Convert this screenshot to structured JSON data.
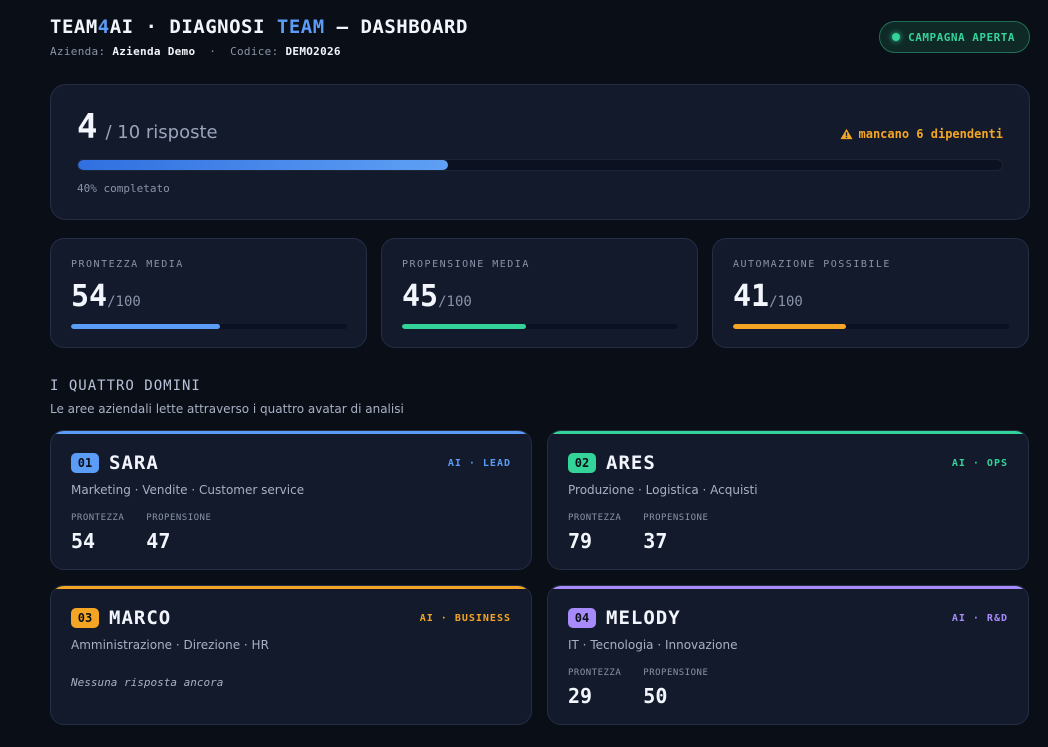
{
  "header": {
    "title_part1": "TEAM",
    "title_part2": "4",
    "title_part3": "AI · DIAGNOSI ",
    "title_part4": "TEAM",
    "title_part5": " — DASHBOARD",
    "azienda_label": "Azienda:",
    "azienda_value": "Azienda Demo",
    "sep": "·",
    "codice_label": "Codice:",
    "codice_value": "DEMO2026",
    "status_badge": "CAMPAGNA APERTA"
  },
  "progress": {
    "count": "4",
    "total_text": "/ 10 risposte",
    "warning": "mancano 6 dipendenti",
    "percent": 40,
    "percent_label": "40% completato",
    "colors": {
      "warning": "#f5a524",
      "bar": "#5b9cf6"
    }
  },
  "metrics": [
    {
      "label": "PRONTEZZA MEDIA",
      "value": "54",
      "suffix": "/100",
      "fill": 0.54,
      "color": "#5b9cf6"
    },
    {
      "label": "PROPENSIONE MEDIA",
      "value": "45",
      "suffix": "/100",
      "fill": 0.45,
      "color": "#34d39a"
    },
    {
      "label": "AUTOMAZIONE POSSIBILE",
      "value": "41",
      "suffix": "/100",
      "fill": 0.41,
      "color": "#f5a524"
    }
  ],
  "section": {
    "title": "I QUATTRO DOMINI",
    "subtitle": "Le aree aziendali lette attraverso i quattro avatar di analisi"
  },
  "domains": [
    {
      "num": "01",
      "name": "SARA",
      "tag": "AI · LEAD",
      "areas": "Marketing · Vendite · Customer service",
      "prontezza_label": "PRONTEZZA",
      "prontezza": "54",
      "propensione_label": "PROPENSIONE",
      "propensione": "47",
      "color": "#5b9cf6"
    },
    {
      "num": "02",
      "name": "ARES",
      "tag": "AI · OPS",
      "areas": "Produzione · Logistica · Acquisti",
      "prontezza_label": "PRONTEZZA",
      "prontezza": "79",
      "propensione_label": "PROPENSIONE",
      "propensione": "37",
      "color": "#34d39a"
    },
    {
      "num": "03",
      "name": "MARCO",
      "tag": "AI · BUSINESS",
      "areas": "Amministrazione · Direzione · HR",
      "empty": "Nessuna risposta ancora",
      "color": "#f5a524"
    },
    {
      "num": "04",
      "name": "MELODY",
      "tag": "AI · R&D",
      "areas": "IT · Tecnologia · Innovazione",
      "prontezza_label": "PRONTEZZA",
      "prontezza": "29",
      "propensione_label": "PROPENSIONE",
      "propensione": "50",
      "color": "#a78bfa"
    }
  ]
}
